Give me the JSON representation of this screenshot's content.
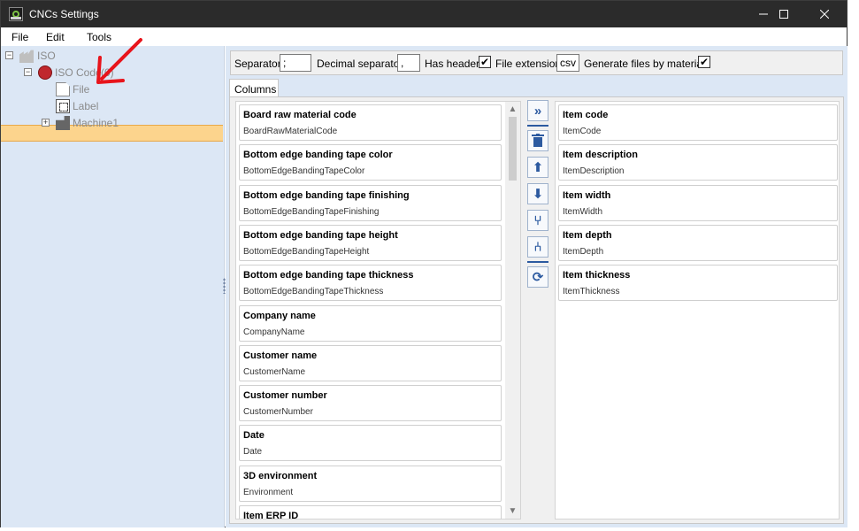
{
  "window": {
    "title": "CNCs Settings"
  },
  "menu": {
    "file": "File",
    "edit": "Edit",
    "tools": "Tools"
  },
  "tree": {
    "root": "ISO",
    "iso_code": "ISO Code",
    "iso_code_suffix": "(0)",
    "file": "File",
    "label": "Label",
    "machine": "Machine1"
  },
  "options": {
    "separator_label": "Separator",
    "separator_value": ";",
    "decimal_label": "Decimal separator",
    "decimal_value": ",",
    "has_header_label": "Has header",
    "has_header_checked": "✔",
    "file_extension_label": "File extension",
    "file_extension_value": "csv",
    "generate_label": "Generate files by material",
    "generate_checked": "✔"
  },
  "tabs": {
    "columns": "Columns"
  },
  "available_columns": [
    {
      "title": "Board raw material code",
      "key": "BoardRawMaterialCode"
    },
    {
      "title": "Bottom edge banding tape color",
      "key": "BottomEdgeBandingTapeColor"
    },
    {
      "title": "Bottom edge banding tape finishing",
      "key": "BottomEdgeBandingTapeFinishing"
    },
    {
      "title": "Bottom edge banding tape height",
      "key": "BottomEdgeBandingTapeHeight"
    },
    {
      "title": "Bottom edge banding tape thickness",
      "key": "BottomEdgeBandingTapeThickness"
    },
    {
      "title": "Company name",
      "key": "CompanyName"
    },
    {
      "title": "Customer name",
      "key": "CustomerName"
    },
    {
      "title": "Customer number",
      "key": "CustomerNumber"
    },
    {
      "title": "Date",
      "key": "Date"
    },
    {
      "title": "3D environment",
      "key": "Environment"
    },
    {
      "title": "Item ERP ID",
      "key": ""
    }
  ],
  "selected_columns": [
    {
      "title": "Item code",
      "key": "ItemCode"
    },
    {
      "title": "Item description",
      "key": "ItemDescription"
    },
    {
      "title": "Item width",
      "key": "ItemWidth"
    },
    {
      "title": "Item depth",
      "key": "ItemDepth"
    },
    {
      "title": "Item thickness",
      "key": "ItemThickness"
    }
  ],
  "icons": {
    "add": "»",
    "delete": "🗑",
    "up": "⬆",
    "down": "⬇",
    "merge": "⑂",
    "split": "⑃",
    "refresh": "⟳"
  },
  "colors": {
    "selection": "#fcd48d",
    "panel": "#dce7f5",
    "accent": "#2c5aa0",
    "arrow": "#e8141b"
  }
}
